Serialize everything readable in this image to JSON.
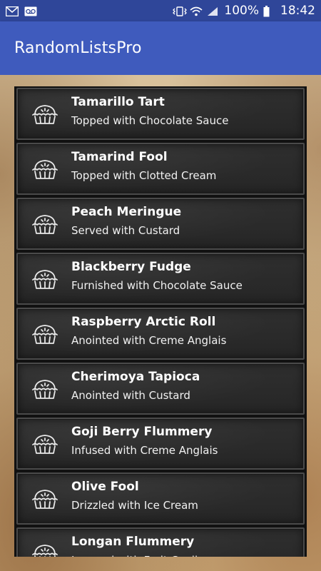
{
  "status_bar": {
    "left_icons": [
      "gmail-icon",
      "voicemail-icon"
    ],
    "right_icons": [
      "vibrate-icon",
      "wifi-icon",
      "cell-signal-icon"
    ],
    "battery": "100%",
    "time": "18:42"
  },
  "app_bar": {
    "title": "RandomListsPro"
  },
  "list": {
    "items": [
      {
        "title": "Tamarillo Tart",
        "subtitle": "Topped with Chocolate Sauce",
        "icon": "pie-icon"
      },
      {
        "title": "Tamarind Fool",
        "subtitle": "Topped with Clotted Cream",
        "icon": "pie-icon"
      },
      {
        "title": "Peach Meringue",
        "subtitle": "Served with Custard",
        "icon": "pie-icon"
      },
      {
        "title": "Blackberry Fudge",
        "subtitle": "Furnished with Chocolate Sauce",
        "icon": "pie-icon"
      },
      {
        "title": "Raspberry Arctic Roll",
        "subtitle": "Anointed with Creme Anglais",
        "icon": "pie-icon"
      },
      {
        "title": "Cherimoya Tapioca",
        "subtitle": "Anointed with Custard",
        "icon": "pie-icon"
      },
      {
        "title": "Goji Berry Flummery",
        "subtitle": "Infused with Creme Anglais",
        "icon": "pie-icon"
      },
      {
        "title": "Olive Fool",
        "subtitle": "Drizzled with Ice Cream",
        "icon": "pie-icon"
      },
      {
        "title": "Longan Flummery",
        "subtitle": "Layered with Fruit Coulis",
        "icon": "pie-icon"
      }
    ]
  },
  "colors": {
    "status_bar": "#2f4699",
    "app_bar": "#3f5bbd",
    "item_background": "#2a2a2a",
    "text": "#ffffff"
  }
}
